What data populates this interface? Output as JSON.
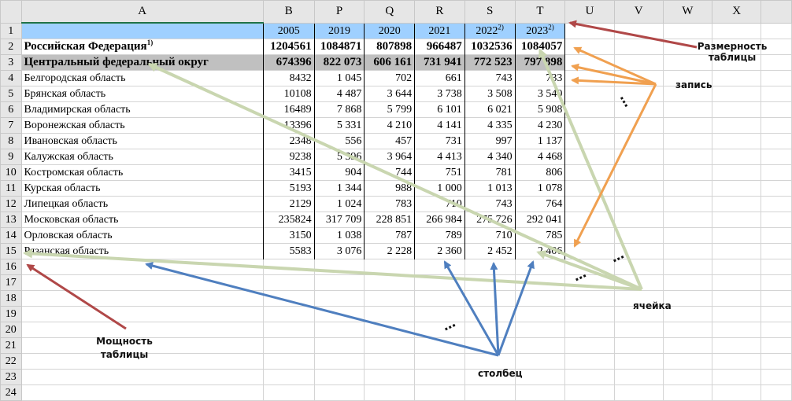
{
  "columns": [
    "A",
    "B",
    "P",
    "Q",
    "R",
    "S",
    "T",
    "U",
    "V",
    "W",
    "X"
  ],
  "row_numbers": [
    1,
    2,
    3,
    4,
    5,
    6,
    7,
    8,
    9,
    10,
    11,
    12,
    13,
    14,
    15,
    16,
    17,
    18,
    19,
    20,
    21,
    22,
    23,
    24
  ],
  "header_row": [
    {
      "year": "2005"
    },
    {
      "year": "2019"
    },
    {
      "year": "2020"
    },
    {
      "year": "2021"
    },
    {
      "year": "2022",
      "note": "2)"
    },
    {
      "year": "2023",
      "note": "2)"
    }
  ],
  "rows": [
    {
      "name": "Российская Федерация",
      "note": "1)",
      "values": [
        "1204561",
        "1084871",
        "807898",
        "966487",
        "1032536",
        "1084057"
      ]
    },
    {
      "name": "Центральный федеральный округ",
      "values": [
        "674396",
        "822 073",
        "606 161",
        "731 941",
        "772 523",
        "797 898"
      ]
    },
    {
      "name": "Белгородская область",
      "values": [
        "8432",
        "1 045",
        "702",
        "661",
        "743",
        "733"
      ]
    },
    {
      "name": "Брянская область",
      "values": [
        "10108",
        "4 487",
        "3 644",
        "3 738",
        "3 508",
        "3 540"
      ]
    },
    {
      "name": "Владимирская область",
      "values": [
        "16489",
        "7 868",
        "5 799",
        "6 101",
        "6 021",
        "5 908"
      ]
    },
    {
      "name": "Воронежская область",
      "values": [
        "13396",
        "5 331",
        "4 210",
        "4 141",
        "4 335",
        "4 230"
      ]
    },
    {
      "name": "Ивановская область",
      "values": [
        "2348",
        "556",
        "457",
        "731",
        "997",
        "1 137"
      ]
    },
    {
      "name": "Калужская область",
      "values": [
        "9238",
        "5 396",
        "3 964",
        "4 413",
        "4 340",
        "4 468"
      ]
    },
    {
      "name": "Костромская область",
      "values": [
        "3415",
        "904",
        "744",
        "751",
        "781",
        "806"
      ]
    },
    {
      "name": "Курская область",
      "values": [
        "5193",
        "1 344",
        "988",
        "1 000",
        "1 013",
        "1 078"
      ]
    },
    {
      "name": "Липецкая область",
      "values": [
        "2129",
        "1 024",
        "783",
        "710",
        "743",
        "764"
      ]
    },
    {
      "name": "Московская область",
      "values": [
        "235824",
        "317 709",
        "228 851",
        "266 984",
        "275 726",
        "292 041"
      ]
    },
    {
      "name": "Орловская область",
      "values": [
        "3150",
        "1 038",
        "787",
        "789",
        "710",
        "785"
      ]
    },
    {
      "name": "Рязанская область",
      "values": [
        "5583",
        "3 076",
        "2 228",
        "2 360",
        "2 452",
        "2 406"
      ]
    }
  ],
  "annotations": {
    "dimension": "Размерность таблицы",
    "record": "запись",
    "cell": "ячейка",
    "column": "столбец",
    "cardinality": "Мощность таблицы",
    "ellipsis": "…"
  },
  "colors": {
    "header_fill": "#9fd0ff",
    "district_fill": "#c0c0c0",
    "cell_arrow": "#c9d6b0",
    "column_arrow": "#4f7fbf",
    "record_arrow": "#f0a050",
    "size_arrow": "#b04848"
  }
}
